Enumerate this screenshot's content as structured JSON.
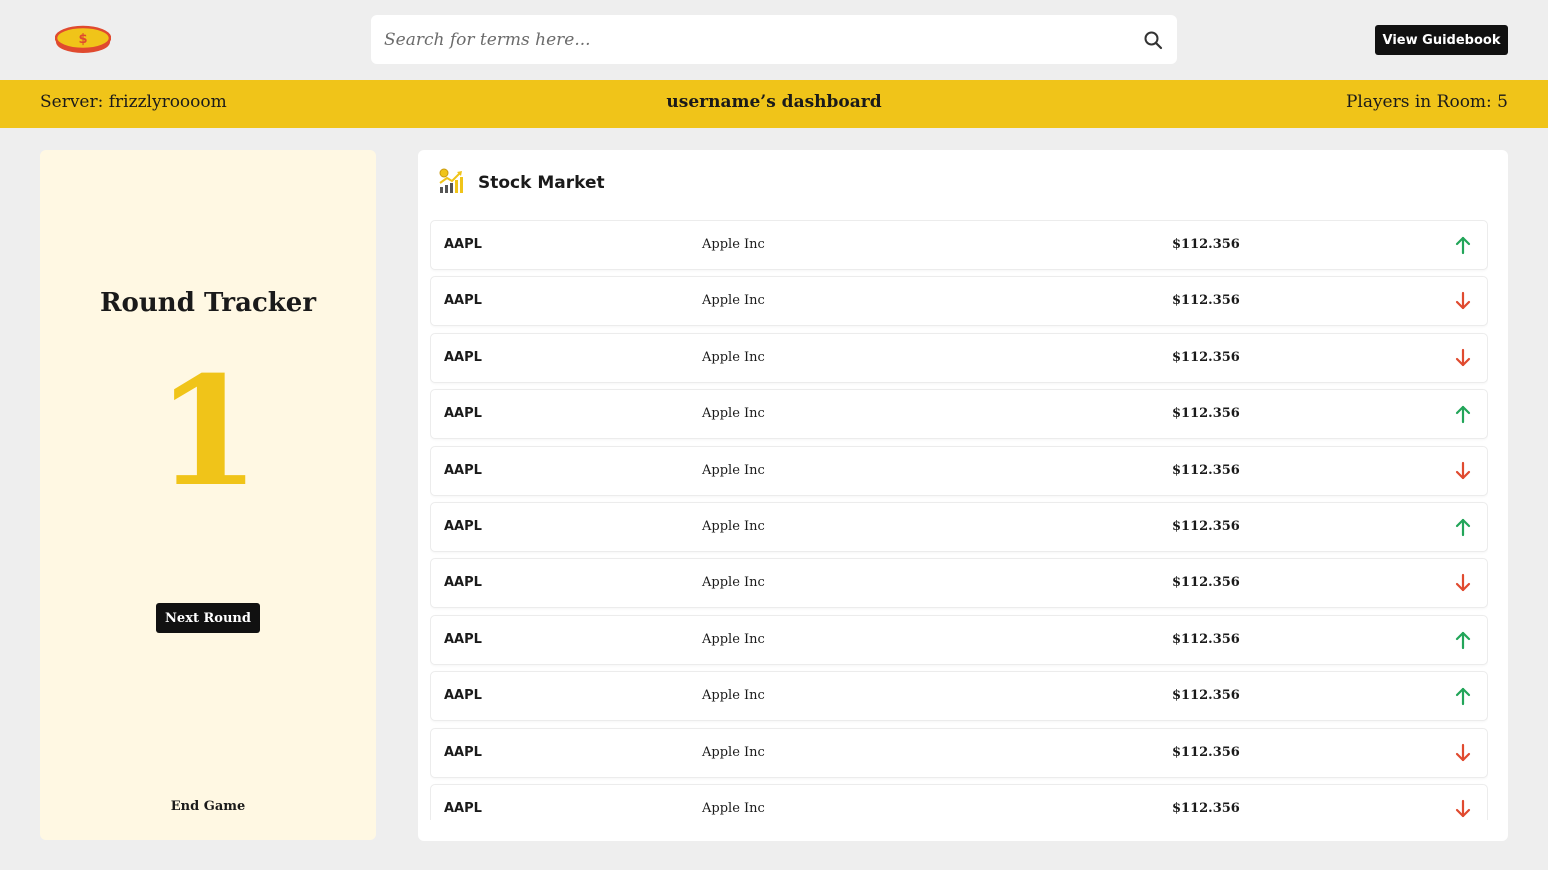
{
  "header": {
    "search_placeholder": "Search for terms here...",
    "guidebook_label": "View Guidebook"
  },
  "infobar": {
    "server": "Server: frizzlyroooom",
    "dashboard_title": "username’s dashboard",
    "players": "Players in Room: 5"
  },
  "tracker": {
    "title": "Round Tracker",
    "round": "1",
    "next_label": "Next Round",
    "end_label": "End Game"
  },
  "market": {
    "title": "Stock Market",
    "stocks": [
      {
        "ticker": "AAPL",
        "name": "Apple Inc",
        "price": "$112.356",
        "trend": "up"
      },
      {
        "ticker": "AAPL",
        "name": "Apple Inc",
        "price": "$112.356",
        "trend": "down"
      },
      {
        "ticker": "AAPL",
        "name": "Apple Inc",
        "price": "$112.356",
        "trend": "down"
      },
      {
        "ticker": "AAPL",
        "name": "Apple Inc",
        "price": "$112.356",
        "trend": "up"
      },
      {
        "ticker": "AAPL",
        "name": "Apple Inc",
        "price": "$112.356",
        "trend": "down"
      },
      {
        "ticker": "AAPL",
        "name": "Apple Inc",
        "price": "$112.356",
        "trend": "up"
      },
      {
        "ticker": "AAPL",
        "name": "Apple Inc",
        "price": "$112.356",
        "trend": "down"
      },
      {
        "ticker": "AAPL",
        "name": "Apple Inc",
        "price": "$112.356",
        "trend": "up"
      },
      {
        "ticker": "AAPL",
        "name": "Apple Inc",
        "price": "$112.356",
        "trend": "up"
      },
      {
        "ticker": "AAPL",
        "name": "Apple Inc",
        "price": "$112.356",
        "trend": "down"
      },
      {
        "ticker": "AAPL",
        "name": "Apple Inc",
        "price": "$112.356",
        "trend": "down"
      }
    ]
  },
  "colors": {
    "accent_yellow": "#f0c419",
    "up_green": "#22a559",
    "down_red": "#e04a2f"
  },
  "icons": {
    "logo": "coin-logo-icon",
    "search": "search-icon",
    "market": "stock-chart-icon",
    "up": "arrow-up-icon",
    "down": "arrow-down-icon"
  }
}
